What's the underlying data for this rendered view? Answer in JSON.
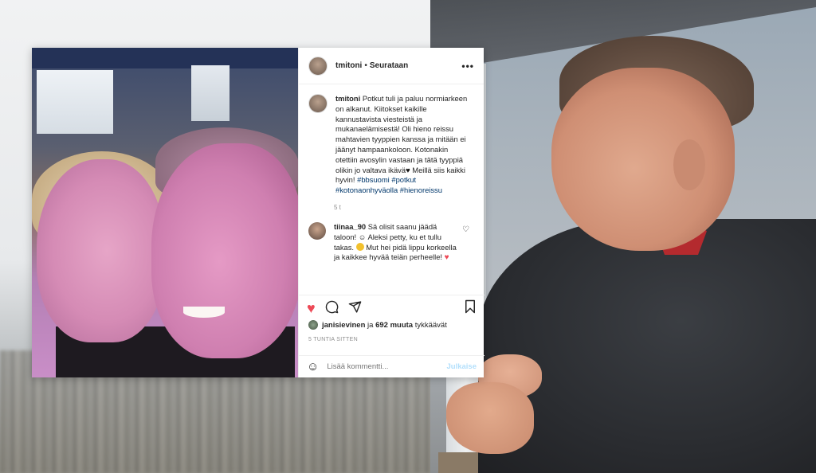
{
  "post": {
    "username": "tmitoni",
    "separator": "•",
    "follow_label": "Seurataan",
    "more_label": "•••",
    "caption": {
      "username": "tmitoni",
      "text": "Potkut tuli ja paluu normiarkeen on alkanut. Kiitokset kaikille kannustavista viesteistä ja mukanaelämisestä! Oli hieno reissu mahtavien tyyppien kanssa ja mitään ei jäänyt hampaankoloon. Kotonakin otettiin avosylin vastaan ja tätä tyyppiä olikin jo valtava ikävä",
      "heart": "♥",
      "text2": "Meillä siis kaikki hyvin!",
      "tags": [
        "#bbsuomi",
        "#potkut",
        "#kotonaonhyväolla",
        "#hienoreissu"
      ],
      "time": "5 t"
    },
    "comment": {
      "username": "tiinaa_90",
      "text1": "Sä olisit saanu jäädä taloon!",
      "text2": "Aleksi petty, ku et tullu takas.",
      "text3": "Mut hei pidä lippu korkeella ja kaikkee hyvää teiän perheelle!",
      "heart": "♥",
      "like_icon": "heart-outline-icon"
    },
    "likes": {
      "first_user": "janisievinen",
      "joiner": "ja",
      "count_text": "692 muuta",
      "suffix": "tykkäävät"
    },
    "time_ago": "5 TUNTIA SITTEN",
    "add_comment": {
      "placeholder": "Lisää kommentti...",
      "post_label": "Julkaise"
    },
    "icons": {
      "like": "heart-filled-icon",
      "comment": "comment-icon",
      "share": "share-icon",
      "save": "bookmark-icon",
      "emoji": "emoji-icon"
    },
    "colors": {
      "like_red": "#ed4956",
      "hashtag_blue": "#00376b",
      "post_disabled": "#b2dffc"
    }
  }
}
